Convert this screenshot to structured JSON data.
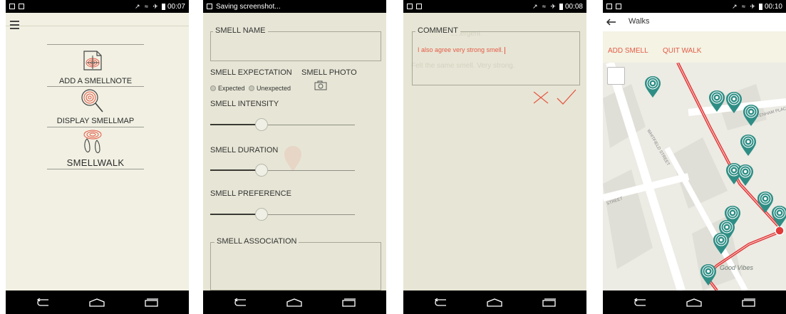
{
  "status_bars": [
    {
      "time": "00:07"
    },
    {
      "notice": "Saving screenshot..."
    },
    {
      "time": "00:08"
    },
    {
      "time": "00:10"
    }
  ],
  "menu": {
    "items": [
      {
        "label": "ADD A SMELLNOTE",
        "icon": "add-smellnote-icon"
      },
      {
        "label": "DISPLAY SMELLMAP",
        "icon": "smellmap-magnifier-icon"
      },
      {
        "label": "SMELLWALK",
        "icon": "footprints-icon"
      }
    ]
  },
  "form": {
    "smell_name_legend": "SMELL NAME",
    "smell_name_value": "",
    "expectation_label": "SMELL EXPECTATION",
    "photo_label": "SMELL PHOTO",
    "expected_option": "Expected",
    "unexpected_option": "Unexpected",
    "intensity_label": "SMELL INTENSITY",
    "duration_label": "SMELL DURATION",
    "preference_label": "SMELL PREFERENCE",
    "association_legend": "SMELL ASSOCIATION",
    "sliders": {
      "intensity": 0.35,
      "duration": 0.35,
      "preference": 0.35
    }
  },
  "comment": {
    "legend": "COMMENT",
    "value": "I also agree very strong smell.",
    "ghost_text": "Felt the same smell. Very strong.",
    "ghost_header": "detergent"
  },
  "walks": {
    "title": "Walks",
    "add_smell": "ADD SMELL",
    "quit_walk": "QUIT WALK",
    "map_labels": [
      "WHITFIELD STREET",
      "TOTTENHAM PLACE",
      "STREET",
      "Good Vibes"
    ]
  },
  "colors": {
    "accent": "#e55b46",
    "teal": "#2e8e85",
    "route": "#e23a3a"
  }
}
